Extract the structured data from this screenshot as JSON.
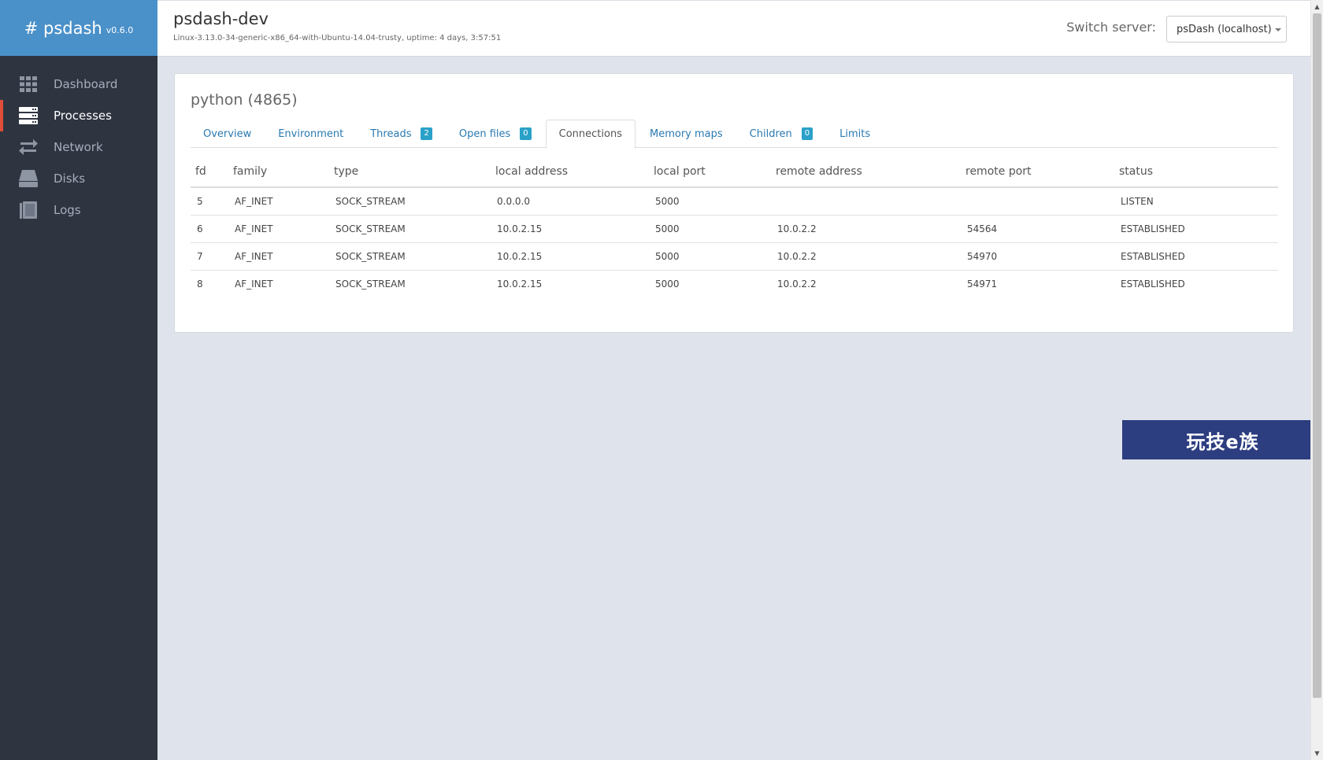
{
  "brand": {
    "name": "# psdash",
    "version": "v0.6.0"
  },
  "sidebar": {
    "items": [
      {
        "label": "Dashboard",
        "icon": "grid-icon",
        "active": false
      },
      {
        "label": "Processes",
        "icon": "server-icon",
        "active": true
      },
      {
        "label": "Network",
        "icon": "arrows-exchange-icon",
        "active": false
      },
      {
        "label": "Disks",
        "icon": "hdd-icon",
        "active": false
      },
      {
        "label": "Logs",
        "icon": "book-icon",
        "active": false
      }
    ]
  },
  "header": {
    "title": "psdash-dev",
    "info": "Linux-3.13.0-34-generic-x86_64-with-Ubuntu-14.04-trusty, uptime: 4 days, 3:57:51",
    "switch_label": "Switch server:",
    "server_selected": "psDash (localhost)"
  },
  "process": {
    "title": "python (4865)",
    "tabs": [
      {
        "label": "Overview",
        "badge": null,
        "active": false
      },
      {
        "label": "Environment",
        "badge": null,
        "active": false
      },
      {
        "label": "Threads",
        "badge": "2",
        "active": false
      },
      {
        "label": "Open files",
        "badge": "0",
        "active": false
      },
      {
        "label": "Connections",
        "badge": null,
        "active": true
      },
      {
        "label": "Memory maps",
        "badge": null,
        "active": false
      },
      {
        "label": "Children",
        "badge": "0",
        "active": false
      },
      {
        "label": "Limits",
        "badge": null,
        "active": false
      }
    ]
  },
  "connections": {
    "columns": [
      "fd",
      "family",
      "type",
      "local address",
      "local port",
      "remote address",
      "remote port",
      "status"
    ],
    "rows": [
      [
        "5",
        "AF_INET",
        "SOCK_STREAM",
        "0.0.0.0",
        "5000",
        "",
        "",
        "LISTEN"
      ],
      [
        "6",
        "AF_INET",
        "SOCK_STREAM",
        "10.0.2.15",
        "5000",
        "10.0.2.2",
        "54564",
        "ESTABLISHED"
      ],
      [
        "7",
        "AF_INET",
        "SOCK_STREAM",
        "10.0.2.15",
        "5000",
        "10.0.2.2",
        "54970",
        "ESTABLISHED"
      ],
      [
        "8",
        "AF_INET",
        "SOCK_STREAM",
        "10.0.2.15",
        "5000",
        "10.0.2.2",
        "54971",
        "ESTABLISHED"
      ]
    ]
  },
  "watermark": {
    "text": "玩技e族"
  }
}
